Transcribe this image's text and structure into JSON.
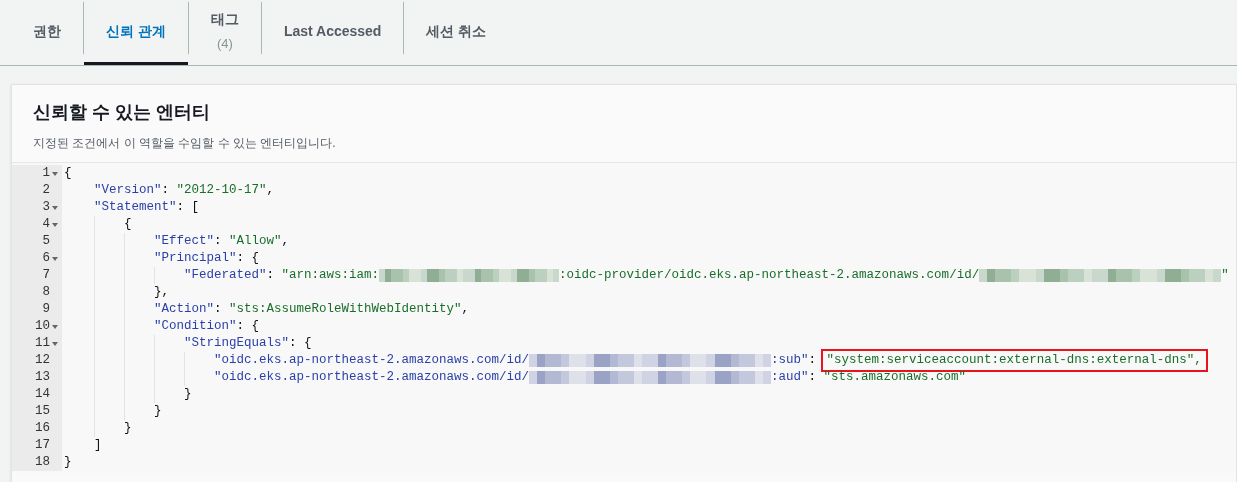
{
  "tabs": [
    {
      "label": "권한",
      "selected": false
    },
    {
      "label": "신뢰 관계",
      "selected": true
    },
    {
      "label": "태그",
      "count": "(4)",
      "selected": false
    },
    {
      "label": "Last Accessed",
      "selected": false
    },
    {
      "label": "세션 취소",
      "selected": false
    }
  ],
  "panel": {
    "title": "신뢰할 수 있는 엔터티",
    "description": "지정된 조건에서 이 역할을 수임할 수 있는 엔터티입니다."
  },
  "editor": {
    "lines": [
      {
        "number": "1",
        "foldable": true,
        "tokens": [
          {
            "kind": "punct",
            "text": "{"
          }
        ],
        "children": [
          {
            "number": "2",
            "foldable": false,
            "tokens": [
              {
                "kind": "key",
                "text": "\"Version\""
              },
              {
                "kind": "punct",
                "text": ": "
              },
              {
                "kind": "str",
                "text": "\"2012-10-17\""
              },
              {
                "kind": "punct",
                "text": ","
              }
            ]
          },
          {
            "number": "3",
            "foldable": true,
            "tokens": [
              {
                "kind": "key",
                "text": "\"Statement\""
              },
              {
                "kind": "punct",
                "text": ": ["
              }
            ],
            "children": [
              {
                "number": "4",
                "foldable": true,
                "tokens": [
                  {
                    "kind": "punct",
                    "text": "{"
                  }
                ],
                "children": [
                  {
                    "number": "5",
                    "foldable": false,
                    "tokens": [
                      {
                        "kind": "key",
                        "text": "\"Effect\""
                      },
                      {
                        "kind": "punct",
                        "text": ": "
                      },
                      {
                        "kind": "str",
                        "text": "\"Allow\""
                      },
                      {
                        "kind": "punct",
                        "text": ","
                      }
                    ]
                  },
                  {
                    "number": "6",
                    "foldable": true,
                    "tokens": [
                      {
                        "kind": "key",
                        "text": "\"Principal\""
                      },
                      {
                        "kind": "punct",
                        "text": ": {"
                      }
                    ],
                    "children": [
                      {
                        "number": "7",
                        "foldable": false,
                        "tokens": [
                          {
                            "kind": "key",
                            "text": "\"Federated\""
                          },
                          {
                            "kind": "punct",
                            "text": ": "
                          },
                          {
                            "kind": "str",
                            "text": "\"arn:aws:iam:"
                          },
                          {
                            "kind": "redacted"
                          },
                          {
                            "kind": "str",
                            "text": ":oidc-provider/oidc.eks.ap-northeast-2.amazonaws.com/id/"
                          },
                          {
                            "kind": "redacted"
                          },
                          {
                            "kind": "str",
                            "text": "\""
                          }
                        ]
                      }
                    ]
                  },
                  {
                    "number": "8",
                    "foldable": false,
                    "tokens": [
                      {
                        "kind": "punct",
                        "text": "},"
                      }
                    ]
                  },
                  {
                    "number": "9",
                    "foldable": false,
                    "tokens": [
                      {
                        "kind": "key",
                        "text": "\"Action\""
                      },
                      {
                        "kind": "punct",
                        "text": ": "
                      },
                      {
                        "kind": "str",
                        "text": "\"sts:AssumeRoleWithWebIdentity\""
                      },
                      {
                        "kind": "punct",
                        "text": ","
                      }
                    ]
                  },
                  {
                    "number": "10",
                    "foldable": true,
                    "tokens": [
                      {
                        "kind": "key",
                        "text": "\"Condition\""
                      },
                      {
                        "kind": "punct",
                        "text": ": {"
                      }
                    ],
                    "children": [
                      {
                        "number": "11",
                        "foldable": true,
                        "tokens": [
                          {
                            "kind": "key",
                            "text": "\"StringEquals\""
                          },
                          {
                            "kind": "punct",
                            "text": ": {"
                          }
                        ],
                        "children": [
                          {
                            "number": "12",
                            "foldable": false,
                            "tokens": [
                              {
                                "kind": "key",
                                "text": "\"oidc.eks.ap-northeast-2.amazonaws.com/id/"
                              },
                              {
                                "kind": "redacted"
                              },
                              {
                                "kind": "key",
                                "text": ":sub\""
                              },
                              {
                                "kind": "punct",
                                "text": ": "
                              },
                              {
                                "kind": "str",
                                "text": "\"system:serviceaccount:external-dns:external-dns\",",
                                "highlighted": true
                              }
                            ]
                          },
                          {
                            "number": "13",
                            "foldable": false,
                            "tokens": [
                              {
                                "kind": "key",
                                "text": "\"oidc.eks.ap-northeast-2.amazonaws.com/id/"
                              },
                              {
                                "kind": "redacted"
                              },
                              {
                                "kind": "key",
                                "text": ":aud\""
                              },
                              {
                                "kind": "punct",
                                "text": ": "
                              },
                              {
                                "kind": "str",
                                "text": "\"sts.amazonaws.com\""
                              }
                            ]
                          }
                        ]
                      },
                      {
                        "number": "14",
                        "foldable": false,
                        "tokens": [
                          {
                            "kind": "punct",
                            "text": "}"
                          }
                        ]
                      }
                    ]
                  },
                  {
                    "number": "15",
                    "foldable": false,
                    "tokens": [
                      {
                        "kind": "punct",
                        "text": "}"
                      }
                    ]
                  }
                ]
              },
              {
                "number": "16",
                "foldable": false,
                "tokens": [
                  {
                    "kind": "punct",
                    "text": "}"
                  }
                ]
              }
            ]
          },
          {
            "number": "17",
            "foldable": false,
            "tokens": [
              {
                "kind": "punct",
                "text": "]"
              }
            ]
          }
        ]
      },
      {
        "number": "18",
        "foldable": false,
        "tokens": [
          {
            "kind": "punct",
            "text": "}"
          }
        ]
      }
    ]
  }
}
